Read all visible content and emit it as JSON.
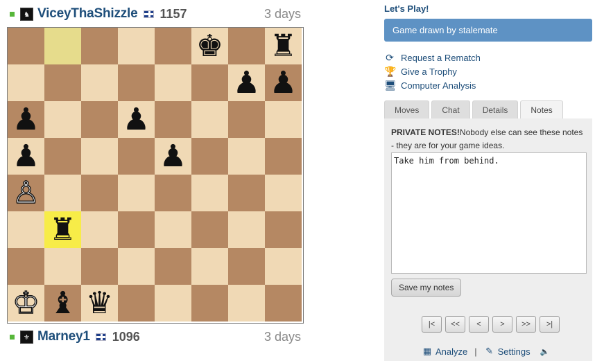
{
  "players": {
    "top": {
      "name": "ViceyThaShizzle",
      "rating": "1157",
      "time": "3 days",
      "avatar_icon": "avatar-icon",
      "flag_icon": "uk-flag-icon"
    },
    "bottom": {
      "name": "Marney1",
      "rating": "1096",
      "time": "3 days",
      "avatar_icon": "avatar-icon",
      "flag_icon": "uk-flag-icon"
    }
  },
  "board": {
    "light_color": "#f0d9b5",
    "dark_color": "#b58863",
    "highlight_from": "b8",
    "highlight_to": "b3",
    "pieces": [
      {
        "square": "f8",
        "piece": "♚",
        "color": "black",
        "name": "black-king"
      },
      {
        "square": "h8",
        "piece": "♜",
        "color": "black",
        "name": "black-rook"
      },
      {
        "square": "g7",
        "piece": "♟",
        "color": "black",
        "name": "black-pawn"
      },
      {
        "square": "h7",
        "piece": "♟",
        "color": "black",
        "name": "black-pawn"
      },
      {
        "square": "a6",
        "piece": "♟",
        "color": "black",
        "name": "black-pawn"
      },
      {
        "square": "d6",
        "piece": "♟",
        "color": "black",
        "name": "black-pawn"
      },
      {
        "square": "a5",
        "piece": "♟",
        "color": "black",
        "name": "black-pawn"
      },
      {
        "square": "e5",
        "piece": "♟",
        "color": "black",
        "name": "black-pawn"
      },
      {
        "square": "a4",
        "piece": "♙",
        "color": "white",
        "name": "white-pawn"
      },
      {
        "square": "b3",
        "piece": "♜",
        "color": "black",
        "name": "black-rook"
      },
      {
        "square": "a1",
        "piece": "♔",
        "color": "white",
        "name": "white-king"
      },
      {
        "square": "b1",
        "piece": "♝",
        "color": "black",
        "name": "black-bishop"
      },
      {
        "square": "c1",
        "piece": "♛",
        "color": "black",
        "name": "black-queen"
      }
    ]
  },
  "panel": {
    "lets_play": "Let's Play!",
    "status": "Game drawn by stalemate",
    "actions": [
      {
        "label": "Request a Rematch",
        "icon": "rematch-icon",
        "glyph": "⟳"
      },
      {
        "label": "Give a Trophy",
        "icon": "trophy-icon",
        "glyph": "🏆"
      },
      {
        "label": "Computer Analysis",
        "icon": "computer-icon",
        "glyph": "🖥"
      }
    ],
    "tabs": [
      "Moves",
      "Chat",
      "Details",
      "Notes"
    ],
    "active_tab": "Notes",
    "notes": {
      "heading": "PRIVATE NOTES!",
      "intro": "Nobody else can see these notes - they are for your game ideas.",
      "value": "Take him from behind.",
      "save_label": "Save my notes"
    },
    "nav_buttons": [
      "|<",
      "<<",
      "<",
      ">",
      ">>",
      ">|"
    ],
    "bottom_links": {
      "analyze": "Analyze",
      "settings": "Settings",
      "separator": "|"
    }
  }
}
